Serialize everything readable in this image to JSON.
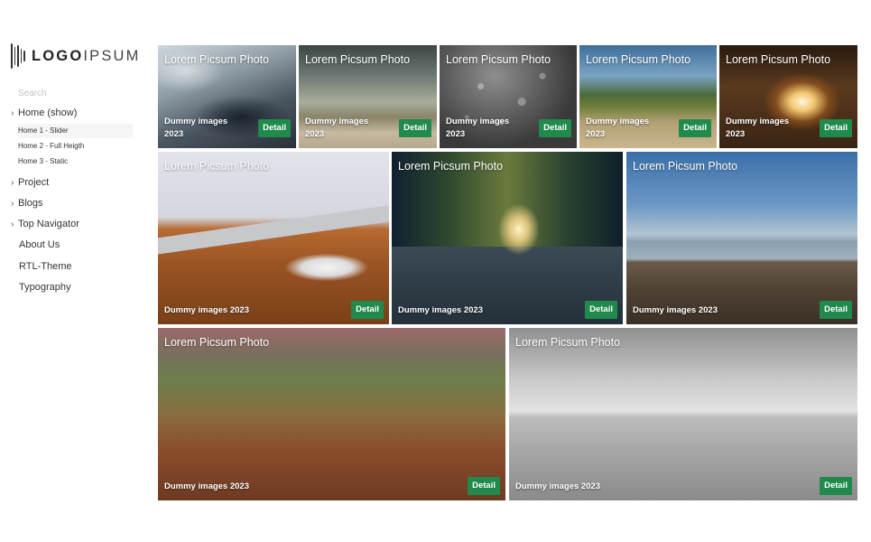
{
  "brand": {
    "logo_bold": "LOGO",
    "logo_light": "IPSUM"
  },
  "sidebar": {
    "search_placeholder": "Search",
    "items": [
      {
        "label": "Home (show)",
        "has_chevron": true
      },
      {
        "label": "Project",
        "has_chevron": true
      },
      {
        "label": "Blogs",
        "has_chevron": true
      },
      {
        "label": "Top Navigator",
        "has_chevron": true
      },
      {
        "label": "About Us",
        "has_chevron": false
      },
      {
        "label": "RTL-Theme",
        "has_chevron": false
      },
      {
        "label": "Typography",
        "has_chevron": false
      }
    ],
    "subitems": [
      {
        "label": "Home 1 - Slider",
        "active": true
      },
      {
        "label": "Home 2 - Full Heigth",
        "active": false
      },
      {
        "label": "Home 3 - Static",
        "active": false
      }
    ]
  },
  "gallery": {
    "tiles": [
      {
        "title": "Lorem Picsum Photo",
        "caption_line1": "Dummy images",
        "caption_line2": "2023",
        "detail": "Detail",
        "scene": "tablet"
      },
      {
        "title": "Lorem Picsum Photo",
        "caption_line1": "Dummy images",
        "caption_line2": "2023",
        "detail": "Detail",
        "scene": "beach-storm"
      },
      {
        "title": "Lorem Picsum Photo",
        "caption_line1": "Dummy images",
        "caption_line2": "2023",
        "detail": "Detail",
        "scene": "raindrops"
      },
      {
        "title": "Lorem Picsum Photo",
        "caption_line1": "Dummy images",
        "caption_line2": "2023",
        "detail": "Detail",
        "scene": "garden"
      },
      {
        "title": "Lorem Picsum Photo",
        "caption_line1": "Dummy images",
        "caption_line2": "2023",
        "detail": "Detail",
        "scene": "concert"
      },
      {
        "title": "Lorem Picsum Photo",
        "caption": "Dummy images 2023",
        "detail": "Detail",
        "scene": "laptop-desk"
      },
      {
        "title": "Lorem Picsum Photo",
        "caption": "Dummy images 2023",
        "detail": "Detail",
        "scene": "forest-road"
      },
      {
        "title": "Lorem Picsum Photo",
        "caption": "Dummy images 2023",
        "detail": "Detail",
        "scene": "bench-sea"
      },
      {
        "title": "Lorem Picsum Photo",
        "caption": "Dummy images 2023",
        "detail": "Detail",
        "scene": "autumn-leaves"
      },
      {
        "title": "Lorem Picsum Photo",
        "caption": "Dummy images 2023",
        "detail": "Detail",
        "scene": "foggy-lake"
      }
    ]
  },
  "colors": {
    "detail_button": "#1f8a4c",
    "active_subitem": "#f5f5f5"
  }
}
